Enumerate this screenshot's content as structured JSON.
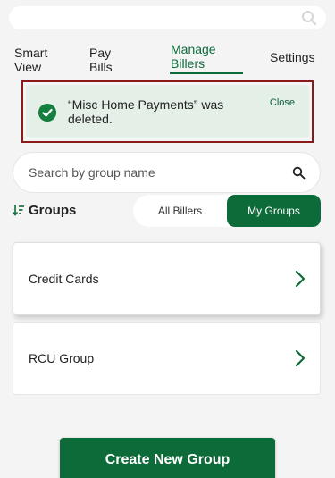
{
  "header": {
    "search": {
      "placeholder": ""
    }
  },
  "nav": {
    "tabs": [
      {
        "label": "Smart\nView",
        "active": false
      },
      {
        "label": "Pay\nBills",
        "active": false
      },
      {
        "label": "Manage\nBillers",
        "active": true
      },
      {
        "label": "Settings",
        "active": false
      }
    ]
  },
  "alert": {
    "message": "“Misc Home Payments” was deleted.",
    "close_label": "Close",
    "status_color": "#148040"
  },
  "group_search": {
    "placeholder": "Search by group name"
  },
  "groups_header": {
    "title": "Groups",
    "toggle": {
      "options": [
        "All Billers",
        "My Groups"
      ],
      "selected": "My Groups"
    }
  },
  "groups": [
    {
      "label": "Credit Cards"
    },
    {
      "label": "RCU Group"
    }
  ],
  "create_button": {
    "label": "Create New Group"
  },
  "colors": {
    "accent": "#0d6b3a",
    "alert_bg": "#e4efe8",
    "highlight_outline": "#8b1a1a"
  }
}
